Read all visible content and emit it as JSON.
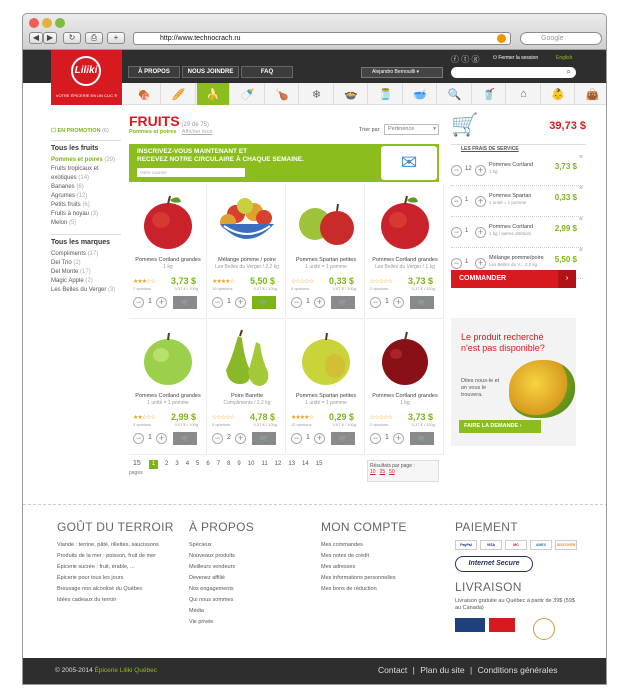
{
  "browser": {
    "url": "http://www.technocrach.ru",
    "search_placeholder": "Google"
  },
  "header": {
    "logo": "Liliki",
    "tagline": "VOTRE ÉPICERIE EN UN CLIC ®",
    "nav": [
      "À PROPOS",
      "NOUS JOINDRE",
      "FAQ"
    ],
    "user": "Alejandro Bernouilli",
    "logout": "Fermer la session",
    "language": "English"
  },
  "categories": [
    "deli-icon",
    "bread-icon",
    "bananas-icon",
    "bottle-icon",
    "meat-icon",
    "frozen-icon",
    "pot-icon",
    "jar-icon",
    "bowl-icon",
    "search-icon",
    "drink-icon",
    "house-icon",
    "baby-icon",
    "bag-icon"
  ],
  "sidebar": {
    "promo": "EN PROMOTION",
    "promo_count": "(6)",
    "fruits_title": "Tous les fruits",
    "fruits": [
      {
        "label": "Pommes et poires",
        "count": "(29)",
        "sel": true
      },
      {
        "label": "Fruits tropicaux et exotiques",
        "count": "(14)"
      },
      {
        "label": "Bananes",
        "count": "(6)"
      },
      {
        "label": "Agrumes",
        "count": "(12)"
      },
      {
        "label": "Petits fruits",
        "count": "(6)"
      },
      {
        "label": "Fruits à noyau",
        "count": "(3)"
      },
      {
        "label": "Melon",
        "count": "(5)"
      }
    ],
    "brands_title": "Tous les marques",
    "brands": [
      {
        "label": "Compliments",
        "count": "(17)"
      },
      {
        "label": "Del Trio",
        "count": "(2)"
      },
      {
        "label": "Del Monte",
        "count": "(17)"
      },
      {
        "label": "Magic Apple",
        "count": "(2)"
      },
      {
        "label": "Les Belles du Verger",
        "count": "(3)"
      }
    ]
  },
  "main": {
    "title": "FRUITS",
    "subtitle": "(29 de 75)",
    "filter": "Pommes et poires",
    "show_all": "Afficher tous",
    "sort_label": "Trier par",
    "sort_value": "Pertinence",
    "banner_line1": "INSCRIVEZ-VOUS MAINTENANT ET",
    "banner_line2": "RECEVEZ NOTRE CIRCULAIRE À CHAQUE SEMAINE.",
    "banner_input": "Votre courriel"
  },
  "products": [
    {
      "name": "Pommes Cortland grandes",
      "sub": "1 kg",
      "price": "3,73 $",
      "unit": "0,37 $ / 100g",
      "votes": "7 opinions",
      "stars": "★★★☆☆",
      "qty": "1",
      "img": "red-apple"
    },
    {
      "name": "Mélange pomme / poire",
      "sub": "Les Belles du Verger / 2,2 kg",
      "price": "5,50 $",
      "unit": "0,27 $ / 100g",
      "votes": "19 opinions",
      "stars": "★★★★☆",
      "qty": "1",
      "img": "fruit-bowl",
      "green": true
    },
    {
      "name": "Pommes Spartan petites",
      "sub": "1 unité = 1 pomme",
      "price": "0,33 $",
      "unit": "0,07 $ / 100g",
      "votes": "0 opinions",
      "stars": "☆☆☆☆☆",
      "qty": "1",
      "img": "two-apples"
    },
    {
      "name": "Pommes Cortland grandes",
      "sub": "Les Belles du Verger / 1 kg",
      "price": "3,73 $",
      "unit": "0,37 $ / 100g",
      "votes": "0 opinions",
      "stars": "☆☆☆☆☆",
      "qty": "1",
      "img": "red-apple"
    },
    {
      "name": "Pommes Cortland grandes",
      "sub": "1 unité = 1 pomme",
      "price": "2,99 $",
      "unit": "0,07 $ / 100g",
      "votes": "3 opinions",
      "stars": "★★☆☆☆",
      "qty": "1",
      "img": "green-apple"
    },
    {
      "name": "Poire Barette",
      "sub": "Compliments / 2,2 kg",
      "price": "4,78 $",
      "unit": "0,37 $ / 100g",
      "votes": "0 opinions",
      "stars": "☆☆☆☆☆",
      "qty": "2",
      "img": "pears"
    },
    {
      "name": "Pommes Spartan petites",
      "sub": "1 unité = 1 pomme",
      "price": "0,29 $",
      "unit": "0,07 $ / 100g",
      "votes": "12 opinions",
      "stars": "★★★★☆",
      "qty": "1",
      "img": "yellow-apple"
    },
    {
      "name": "Pommes Cortland grandes",
      "sub": "1 kg",
      "price": "3,73 $",
      "unit": "0,37 $ / 100g",
      "votes": "0 opinions",
      "stars": "☆☆☆☆☆",
      "qty": "1",
      "img": "dark-apple"
    }
  ],
  "pagination": {
    "current": "1",
    "total_label": "15",
    "pages_label": "pages",
    "pages": [
      "2",
      "3",
      "4",
      "5",
      "6",
      "7",
      "8",
      "9",
      "10",
      "11",
      "12",
      "13",
      "14",
      "15"
    ],
    "per_page_label": "Résultats par page :",
    "per_page": [
      "10",
      "25",
      "50"
    ]
  },
  "cart": {
    "total": "39,73 $",
    "fees": "LES FRAIS DE SERVICE",
    "items": [
      {
        "qty": "12",
        "name": "Pommes Cortland",
        "sub": "1 kg",
        "price": "3,73 $"
      },
      {
        "qty": "1",
        "name": "Pommes Spartan",
        "sub": "1 unité = 1 pomme",
        "price": "0,33 $"
      },
      {
        "qty": "1",
        "name": "Pommes Cortland",
        "sub": "1 kg / autres attributs",
        "price": "2,99 $"
      },
      {
        "qty": "1",
        "name": "Mélange pomme/poire",
        "sub": "Les Belles du V... 2,2 kg",
        "price": "5,50 $"
      }
    ],
    "order_btn": "COMMANDER"
  },
  "promo_box": {
    "title": "Le produit recherché n'est pas disponible?",
    "text": "Dites nous-le et on vous le trouvera.",
    "btn": "FAIRE LA DEMANDE"
  },
  "footer": {
    "col1_title": "GOÛT DU TERROIR",
    "col1": [
      "Viande : terrine, pâté, rillettes, saucissons",
      "Produits de la mer : poisson, fruit de mer",
      "Épicerie sucrée : fruit, érable, ...",
      "Épicerie pour tous les jours",
      "Breuvage non alcoolisé du Québec",
      "Idées cadeaux du terroir"
    ],
    "col2_title": "À PROPOS",
    "col2": [
      "Spécieux",
      "Nouveaux produits",
      "Meilleurs vendeurs",
      "Devenez affilié",
      "Nos engagements",
      "Qui nous sommes",
      "Média",
      "Vie privée"
    ],
    "col3_title": "MON COMPTE",
    "col3": [
      "Mes commandes",
      "Mes notes de crédit",
      "Mes adresses",
      "Mes informations personnelles",
      "Mes bons de réduction"
    ],
    "col4_title": "PAIEMENT",
    "payment": [
      "PayPal",
      "VISA",
      "MC",
      "AMEX",
      "DISCOVER"
    ],
    "secure": "Internet Secure",
    "livraison_title": "LIVRAISON",
    "livraison": "Livraison gratuite au Québec à partir de 39$ (59$ au Canada)",
    "copyright": "© 2005-2014",
    "brand": "Épicerie Liliki Québec",
    "links": [
      "Contact",
      "Plan du site",
      "Conditions générales"
    ]
  }
}
